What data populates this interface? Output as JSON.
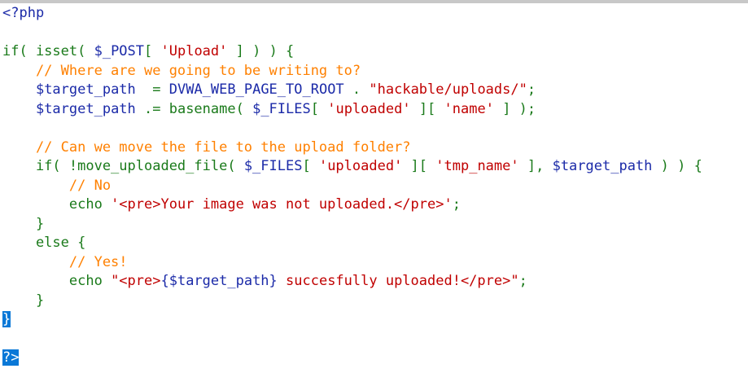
{
  "colors": {
    "keyword": "#1a7a1a",
    "variable": "#1b2aa8",
    "string": "#c00000",
    "comment": "#ff8000",
    "selection": "#0a78d7"
  },
  "lines": [
    [
      {
        "t": "<?php",
        "c": "t"
      }
    ],
    [],
    [
      {
        "t": "if( isset( ",
        "c": "k"
      },
      {
        "t": "$_POST",
        "c": "v"
      },
      {
        "t": "[ ",
        "c": "k"
      },
      {
        "t": "'Upload'",
        "c": "s"
      },
      {
        "t": " ] ) ) {",
        "c": "k"
      }
    ],
    [
      {
        "t": "    // Where are we going to be writing to?",
        "c": "c"
      }
    ],
    [
      {
        "t": "    ",
        "c": "k"
      },
      {
        "t": "$target_path",
        "c": "v"
      },
      {
        "t": "  = ",
        "c": "k"
      },
      {
        "t": "DVWA_WEB_PAGE_TO_ROOT",
        "c": "v"
      },
      {
        "t": " . ",
        "c": "k"
      },
      {
        "t": "\"hackable/uploads/\"",
        "c": "s"
      },
      {
        "t": ";",
        "c": "k"
      }
    ],
    [
      {
        "t": "    ",
        "c": "k"
      },
      {
        "t": "$target_path",
        "c": "v"
      },
      {
        "t": " .= basename( ",
        "c": "k"
      },
      {
        "t": "$_FILES",
        "c": "v"
      },
      {
        "t": "[ ",
        "c": "k"
      },
      {
        "t": "'uploaded'",
        "c": "s"
      },
      {
        "t": " ][ ",
        "c": "k"
      },
      {
        "t": "'name'",
        "c": "s"
      },
      {
        "t": " ] );",
        "c": "k"
      }
    ],
    [],
    [
      {
        "t": "    // Can we move the file to the upload folder?",
        "c": "c"
      }
    ],
    [
      {
        "t": "    if( !move_uploaded_file( ",
        "c": "k"
      },
      {
        "t": "$_FILES",
        "c": "v"
      },
      {
        "t": "[ ",
        "c": "k"
      },
      {
        "t": "'uploaded'",
        "c": "s"
      },
      {
        "t": " ][ ",
        "c": "k"
      },
      {
        "t": "'tmp_name'",
        "c": "s"
      },
      {
        "t": " ], ",
        "c": "k"
      },
      {
        "t": "$target_path",
        "c": "v"
      },
      {
        "t": " ) ) {",
        "c": "k"
      }
    ],
    [
      {
        "t": "        // No",
        "c": "c"
      }
    ],
    [
      {
        "t": "        echo ",
        "c": "k"
      },
      {
        "t": "'<pre>Your image was not uploaded.</pre>'",
        "c": "s"
      },
      {
        "t": ";",
        "c": "k"
      }
    ],
    [
      {
        "t": "    }",
        "c": "k"
      }
    ],
    [
      {
        "t": "    else {",
        "c": "k"
      }
    ],
    [
      {
        "t": "        // Yes!",
        "c": "c"
      }
    ],
    [
      {
        "t": "        echo ",
        "c": "k"
      },
      {
        "t": "\"<pre>",
        "c": "s"
      },
      {
        "t": "{$target_path}",
        "c": "v"
      },
      {
        "t": " succesfully uploaded!</pre>\"",
        "c": "s"
      },
      {
        "t": ";",
        "c": "k"
      }
    ],
    [
      {
        "t": "    }",
        "c": "k"
      }
    ],
    [
      {
        "t": "}",
        "c": "sel"
      }
    ],
    [],
    [
      {
        "t": "?>",
        "c": "sel"
      }
    ]
  ]
}
